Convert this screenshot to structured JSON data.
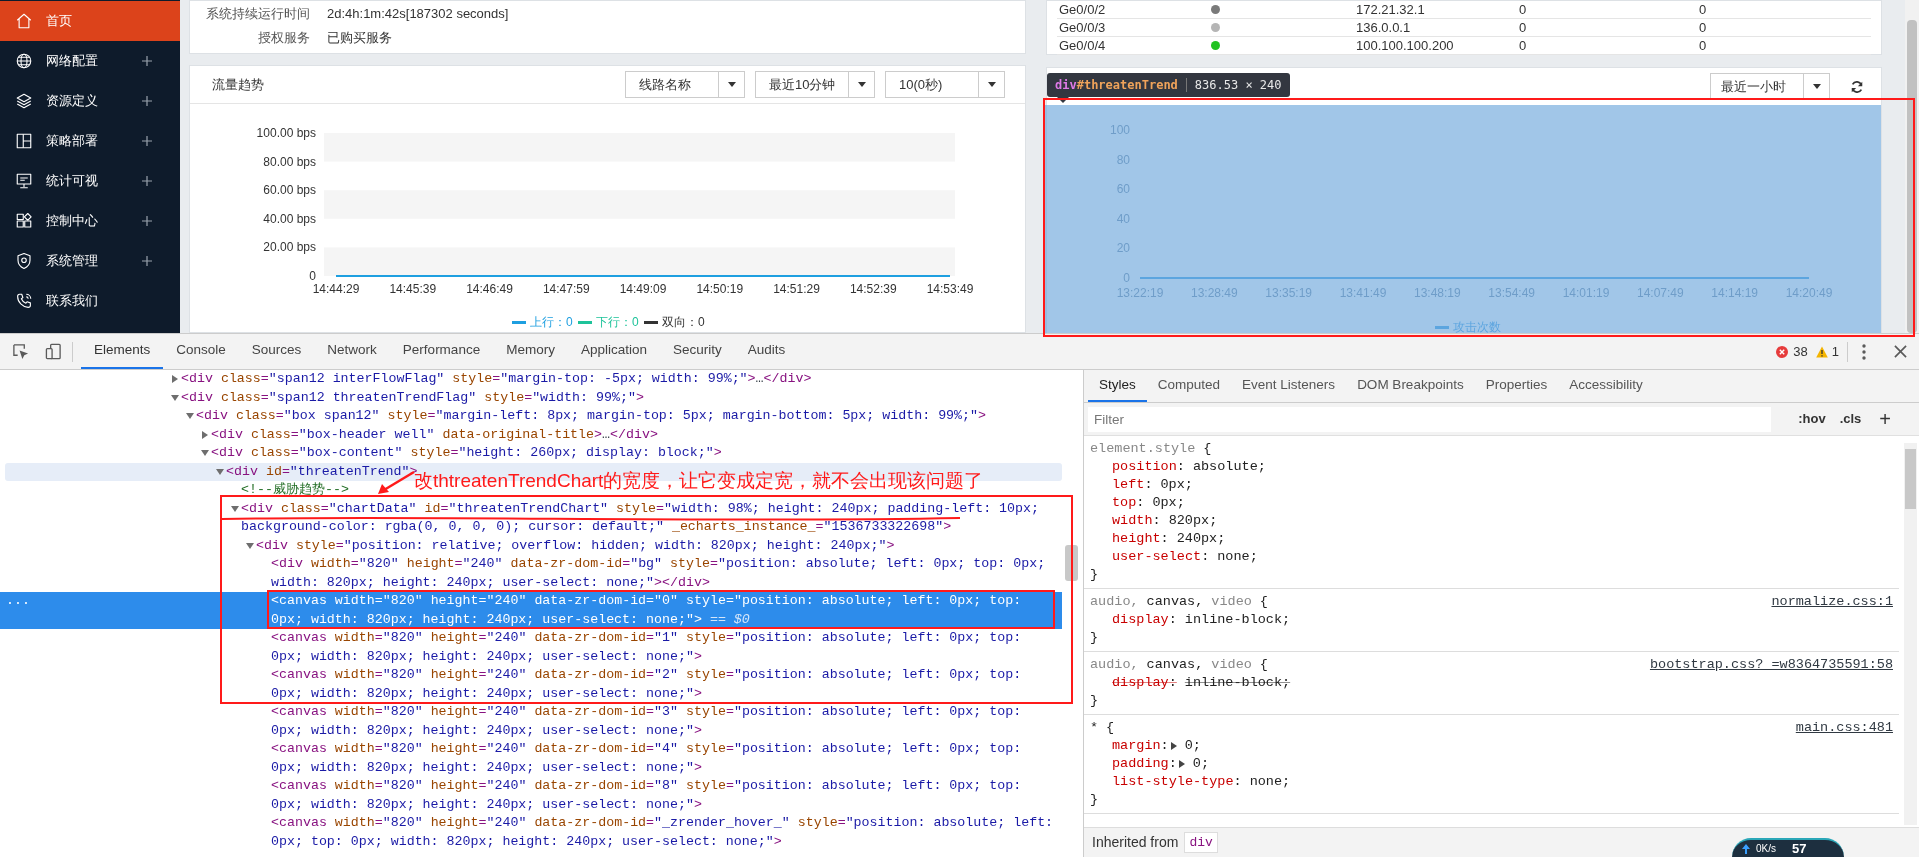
{
  "sidebar": {
    "items": [
      {
        "label": "首页",
        "selected": true,
        "expandable": false
      },
      {
        "label": "网络配置",
        "selected": false,
        "expandable": true
      },
      {
        "label": "资源定义",
        "selected": false,
        "expandable": true
      },
      {
        "label": "策略部署",
        "selected": false,
        "expandable": true
      },
      {
        "label": "统计可视",
        "selected": false,
        "expandable": true
      },
      {
        "label": "控制中心",
        "selected": false,
        "expandable": true
      },
      {
        "label": "系统管理",
        "selected": false,
        "expandable": true
      },
      {
        "label": "联系我们",
        "selected": false,
        "expandable": false
      }
    ]
  },
  "info_card": {
    "rows": [
      {
        "label": "系统持续运行时间",
        "value": "2d:4h:1m:42s[187302 seconds]"
      },
      {
        "label": "授权服务",
        "value": "已购买服务"
      }
    ]
  },
  "traffic_card": {
    "title": "流量趋势",
    "selects": [
      "线路名称",
      "最近10分钟",
      "10(0秒)"
    ],
    "chart_data": {
      "type": "line",
      "categories": [
        "14:44:29",
        "14:45:39",
        "14:46:49",
        "14:47:59",
        "14:49:09",
        "14:50:19",
        "14:51:29",
        "14:52:39",
        "14:53:49"
      ],
      "ylim": [
        0,
        100
      ],
      "yticks": [
        {
          "value": 0,
          "label": "0"
        },
        {
          "value": 20,
          "label": "20.00 bps"
        },
        {
          "value": 40,
          "label": "40.00 bps"
        },
        {
          "value": 60,
          "label": "60.00 bps"
        },
        {
          "value": 80,
          "label": "80.00 bps"
        },
        {
          "value": 100,
          "label": "100.00 bps"
        }
      ],
      "series": [
        {
          "name": "上行：0",
          "color": "#1e9fe0",
          "values": [
            0,
            0,
            0,
            0,
            0,
            0,
            0,
            0,
            0
          ]
        },
        {
          "name": "下行：0",
          "color": "#1ec39a",
          "values": [
            null,
            null,
            null,
            null,
            null,
            null,
            null,
            null,
            null
          ]
        },
        {
          "name": "双向：0",
          "color": "#333333",
          "values": [
            null,
            null,
            null,
            null,
            null,
            null,
            null,
            null,
            null
          ]
        }
      ],
      "legend": "bottom"
    }
  },
  "interface_table": {
    "rows": [
      {
        "name": "Ge0/0/2",
        "color": "#7a7a7a",
        "ip": "172.21.32.1",
        "column_4": "0",
        "column_5": "0"
      },
      {
        "name": "Ge0/0/3",
        "color": "#b5b5b5",
        "ip": "136.0.0.1",
        "column_4": "0",
        "column_5": "0"
      },
      {
        "name": "Ge0/0/4",
        "color": "#22c322",
        "ip": "100.100.100.200",
        "column_4": "0",
        "column_5": "0"
      }
    ]
  },
  "threat_card": {
    "select": "最近一小时",
    "chart_data": {
      "type": "line",
      "categories": [
        "13:22:19",
        "13:28:49",
        "13:35:19",
        "13:41:49",
        "13:48:19",
        "13:54:49",
        "14:01:19",
        "14:07:49",
        "14:14:19",
        "14:20:49"
      ],
      "ylim": [
        0,
        100
      ],
      "yticks": [
        0,
        20,
        40,
        60,
        80,
        100
      ],
      "series": [
        {
          "name": "攻击次数",
          "color": "#3ba0e6",
          "values": [
            0,
            0,
            0,
            0,
            0,
            0,
            0,
            0,
            0,
            0
          ]
        }
      ],
      "legend": "bottom"
    }
  },
  "inspect_tooltip": {
    "tag": "div",
    "id": "#threatenTrend",
    "size": "836.53 × 240"
  },
  "annotation_note": "改thtreatenTrendChart的宽度，让它变成定宽，就不会出现该问题了",
  "devtools": {
    "tabs": [
      {
        "label": "Elements",
        "selected": true
      },
      {
        "label": "Console",
        "selected": false
      },
      {
        "label": "Sources",
        "selected": false
      },
      {
        "label": "Network",
        "selected": false
      },
      {
        "label": "Performance",
        "selected": false
      },
      {
        "label": "Memory",
        "selected": false
      },
      {
        "label": "Application",
        "selected": false
      },
      {
        "label": "Security",
        "selected": false
      },
      {
        "label": "Audits",
        "selected": false
      }
    ],
    "errors": "38",
    "warnings": "1",
    "elements_tree": [
      {
        "kind": "branch",
        "markup": "<div class=\"span12 interFlowFlag\" style=\"margin-top: -5px; width: 99%;\">…</div>",
        "expanded": false,
        "selected": false,
        "hovered": false
      },
      {
        "kind": "branch",
        "markup": "<div class=\"span12 threatenTrendFlag\" style=\"width: 99%;\">",
        "expanded": true,
        "selected": false,
        "hovered": false,
        "children": [
          {
            "kind": "branch",
            "markup": "<div class=\"box span12\" style=\"margin-left: 8px; margin-top: 5px; margin-bottom: 5px; width: 99%;\">",
            "expanded": true,
            "selected": false,
            "hovered": false,
            "children": [
              {
                "kind": "branch",
                "markup": "<div class=\"box-header well\" data-original-title>…</div>",
                "expanded": false,
                "selected": false,
                "hovered": false
              },
              {
                "kind": "branch",
                "markup": "<div class=\"box-content\" style=\"height: 260px; display: block;\">",
                "expanded": true,
                "selected": false,
                "hovered": false,
                "children": [
                  {
                    "kind": "branch",
                    "markup": "<div id=\"threatenTrend\">",
                    "expanded": true,
                    "selected": false,
                    "hovered": true,
                    "children": [
                      {
                        "kind": "comment",
                        "markup": "<!--威胁趋势-->",
                        "selected": false,
                        "hovered": false
                      },
                      {
                        "kind": "branch",
                        "markup": "<div class=\"chartData\" id=\"threatenTrendChart\" style=\"width: 98%; height: 240px; padding-left: 10px; background-color: rgba(0, 0, 0, 0); cursor: default;\" _echarts_instance_=\"1536733322698\">",
                        "expanded": true,
                        "selected": false,
                        "hovered": false,
                        "children": [
                          {
                            "kind": "branch",
                            "markup": "<div style=\"position: relative; overflow: hidden; width: 820px; height: 240px;\">",
                            "expanded": true,
                            "selected": false,
                            "hovered": false,
                            "children": [
                              {
                                "kind": "leaf",
                                "markup": "<div width=\"820\" height=\"240\" data-zr-dom-id=\"bg\" style=\"position: absolute; left: 0px; top: 0px; width: 820px; height: 240px; user-select: none;\"></div>",
                                "selected": false,
                                "hovered": false
                              },
                              {
                                "kind": "leaf",
                                "markup": "<canvas width=\"820\" height=\"240\" data-zr-dom-id=\"0\" style=\"position: absolute; left: 0px; top: 0px; width: 820px; height: 240px; user-select: none;\">",
                                "selected": true,
                                "hovered": false,
                                "suffix": "== $0",
                                "gutter": "..."
                              },
                              {
                                "kind": "leaf",
                                "markup": "<canvas width=\"820\" height=\"240\" data-zr-dom-id=\"1\" style=\"position: absolute; left: 0px; top: 0px; width: 820px; height: 240px; user-select: none;\">",
                                "selected": false,
                                "hovered": false
                              },
                              {
                                "kind": "leaf",
                                "markup": "<canvas width=\"820\" height=\"240\" data-zr-dom-id=\"2\" style=\"position: absolute; left: 0px; top: 0px; width: 820px; height: 240px; user-select: none;\">",
                                "selected": false,
                                "hovered": false
                              },
                              {
                                "kind": "leaf",
                                "markup": "<canvas width=\"820\" height=\"240\" data-zr-dom-id=\"3\" style=\"position: absolute; left: 0px; top: 0px; width: 820px; height: 240px; user-select: none;\">",
                                "selected": false,
                                "hovered": false
                              },
                              {
                                "kind": "leaf",
                                "markup": "<canvas width=\"820\" height=\"240\" data-zr-dom-id=\"4\" style=\"position: absolute; left: 0px; top: 0px; width: 820px; height: 240px; user-select: none;\">",
                                "selected": false,
                                "hovered": false
                              },
                              {
                                "kind": "leaf",
                                "markup": "<canvas width=\"820\" height=\"240\" data-zr-dom-id=\"8\" style=\"position: absolute; left: 0px; top: 0px; width: 820px; height: 240px; user-select: none;\">",
                                "selected": false,
                                "hovered": false
                              },
                              {
                                "kind": "leaf",
                                "markup": "<canvas width=\"820\" height=\"240\" data-zr-dom-id=\"_zrender_hover_\" style=\"position: absolute; left: 0px; top: 0px; width: 820px; height: 240px; user-select: none;\">",
                                "selected": false,
                                "hovered": false
                              }
                            ]
                          }
                        ]
                      }
                    ]
                  }
                ]
              }
            ]
          }
        ]
      }
    ],
    "styles_tabs": [
      {
        "label": "Styles",
        "selected": true
      },
      {
        "label": "Computed",
        "selected": false
      },
      {
        "label": "Event Listeners",
        "selected": false
      },
      {
        "label": "DOM Breakpoints",
        "selected": false
      },
      {
        "label": "Properties",
        "selected": false
      },
      {
        "label": "Accessibility",
        "selected": false
      }
    ],
    "filter": {
      "placeholder": "Filter"
    },
    "filter_buttons": [
      ":hov",
      ".cls",
      "+"
    ],
    "rules": [
      {
        "selector": [
          {
            "text": "element.style",
            "matched": false
          }
        ],
        "open": "{",
        "close": "}",
        "declarations": [
          {
            "property": "position:",
            "value": "absolute;",
            "overridden": false,
            "expandable": false
          },
          {
            "property": "left:",
            "value": "0px;",
            "overridden": false,
            "expandable": false
          },
          {
            "property": "top:",
            "value": "0px;",
            "overridden": false,
            "expandable": false
          },
          {
            "property": "width:",
            "value": "820px;",
            "overridden": false,
            "expandable": false
          },
          {
            "property": "height:",
            "value": "240px;",
            "overridden": false,
            "expandable": false
          },
          {
            "property": "user-select:",
            "value": "none;",
            "overridden": false,
            "expandable": false
          }
        ]
      },
      {
        "selector": [
          {
            "text": "audio,",
            "matched": false
          },
          {
            "text": "canvas,",
            "matched": true
          },
          {
            "text": "video",
            "matched": false
          }
        ],
        "open": "{",
        "close": "}",
        "source": "normalize.css:1",
        "declarations": [
          {
            "property": "display:",
            "value": "inline-block;",
            "overridden": false,
            "expandable": false
          }
        ]
      },
      {
        "selector": [
          {
            "text": "audio,",
            "matched": false
          },
          {
            "text": "canvas,",
            "matched": true
          },
          {
            "text": "video",
            "matched": false
          }
        ],
        "open": "{",
        "close": "}",
        "source": "bootstrap.css?_=w8364735591:58",
        "declarations": [
          {
            "property": "display:",
            "value": "inline-block;",
            "overridden": true,
            "expandable": false
          }
        ]
      },
      {
        "selector": [
          {
            "text": "*",
            "matched": true
          }
        ],
        "open": "{",
        "close": "}",
        "source": "main.css:481",
        "declarations": [
          {
            "property": "margin:",
            "value": "0;",
            "overridden": false,
            "expandable": true
          },
          {
            "property": "padding:",
            "value": "0;",
            "overridden": false,
            "expandable": true
          },
          {
            "property": "list-style-type:",
            "value": "none;",
            "overridden": false,
            "expandable": false
          }
        ]
      }
    ],
    "inherited": {
      "label": "Inherited from",
      "node": "div"
    }
  },
  "speed_widget": {
    "rate": "0K/s",
    "value": "57"
  }
}
